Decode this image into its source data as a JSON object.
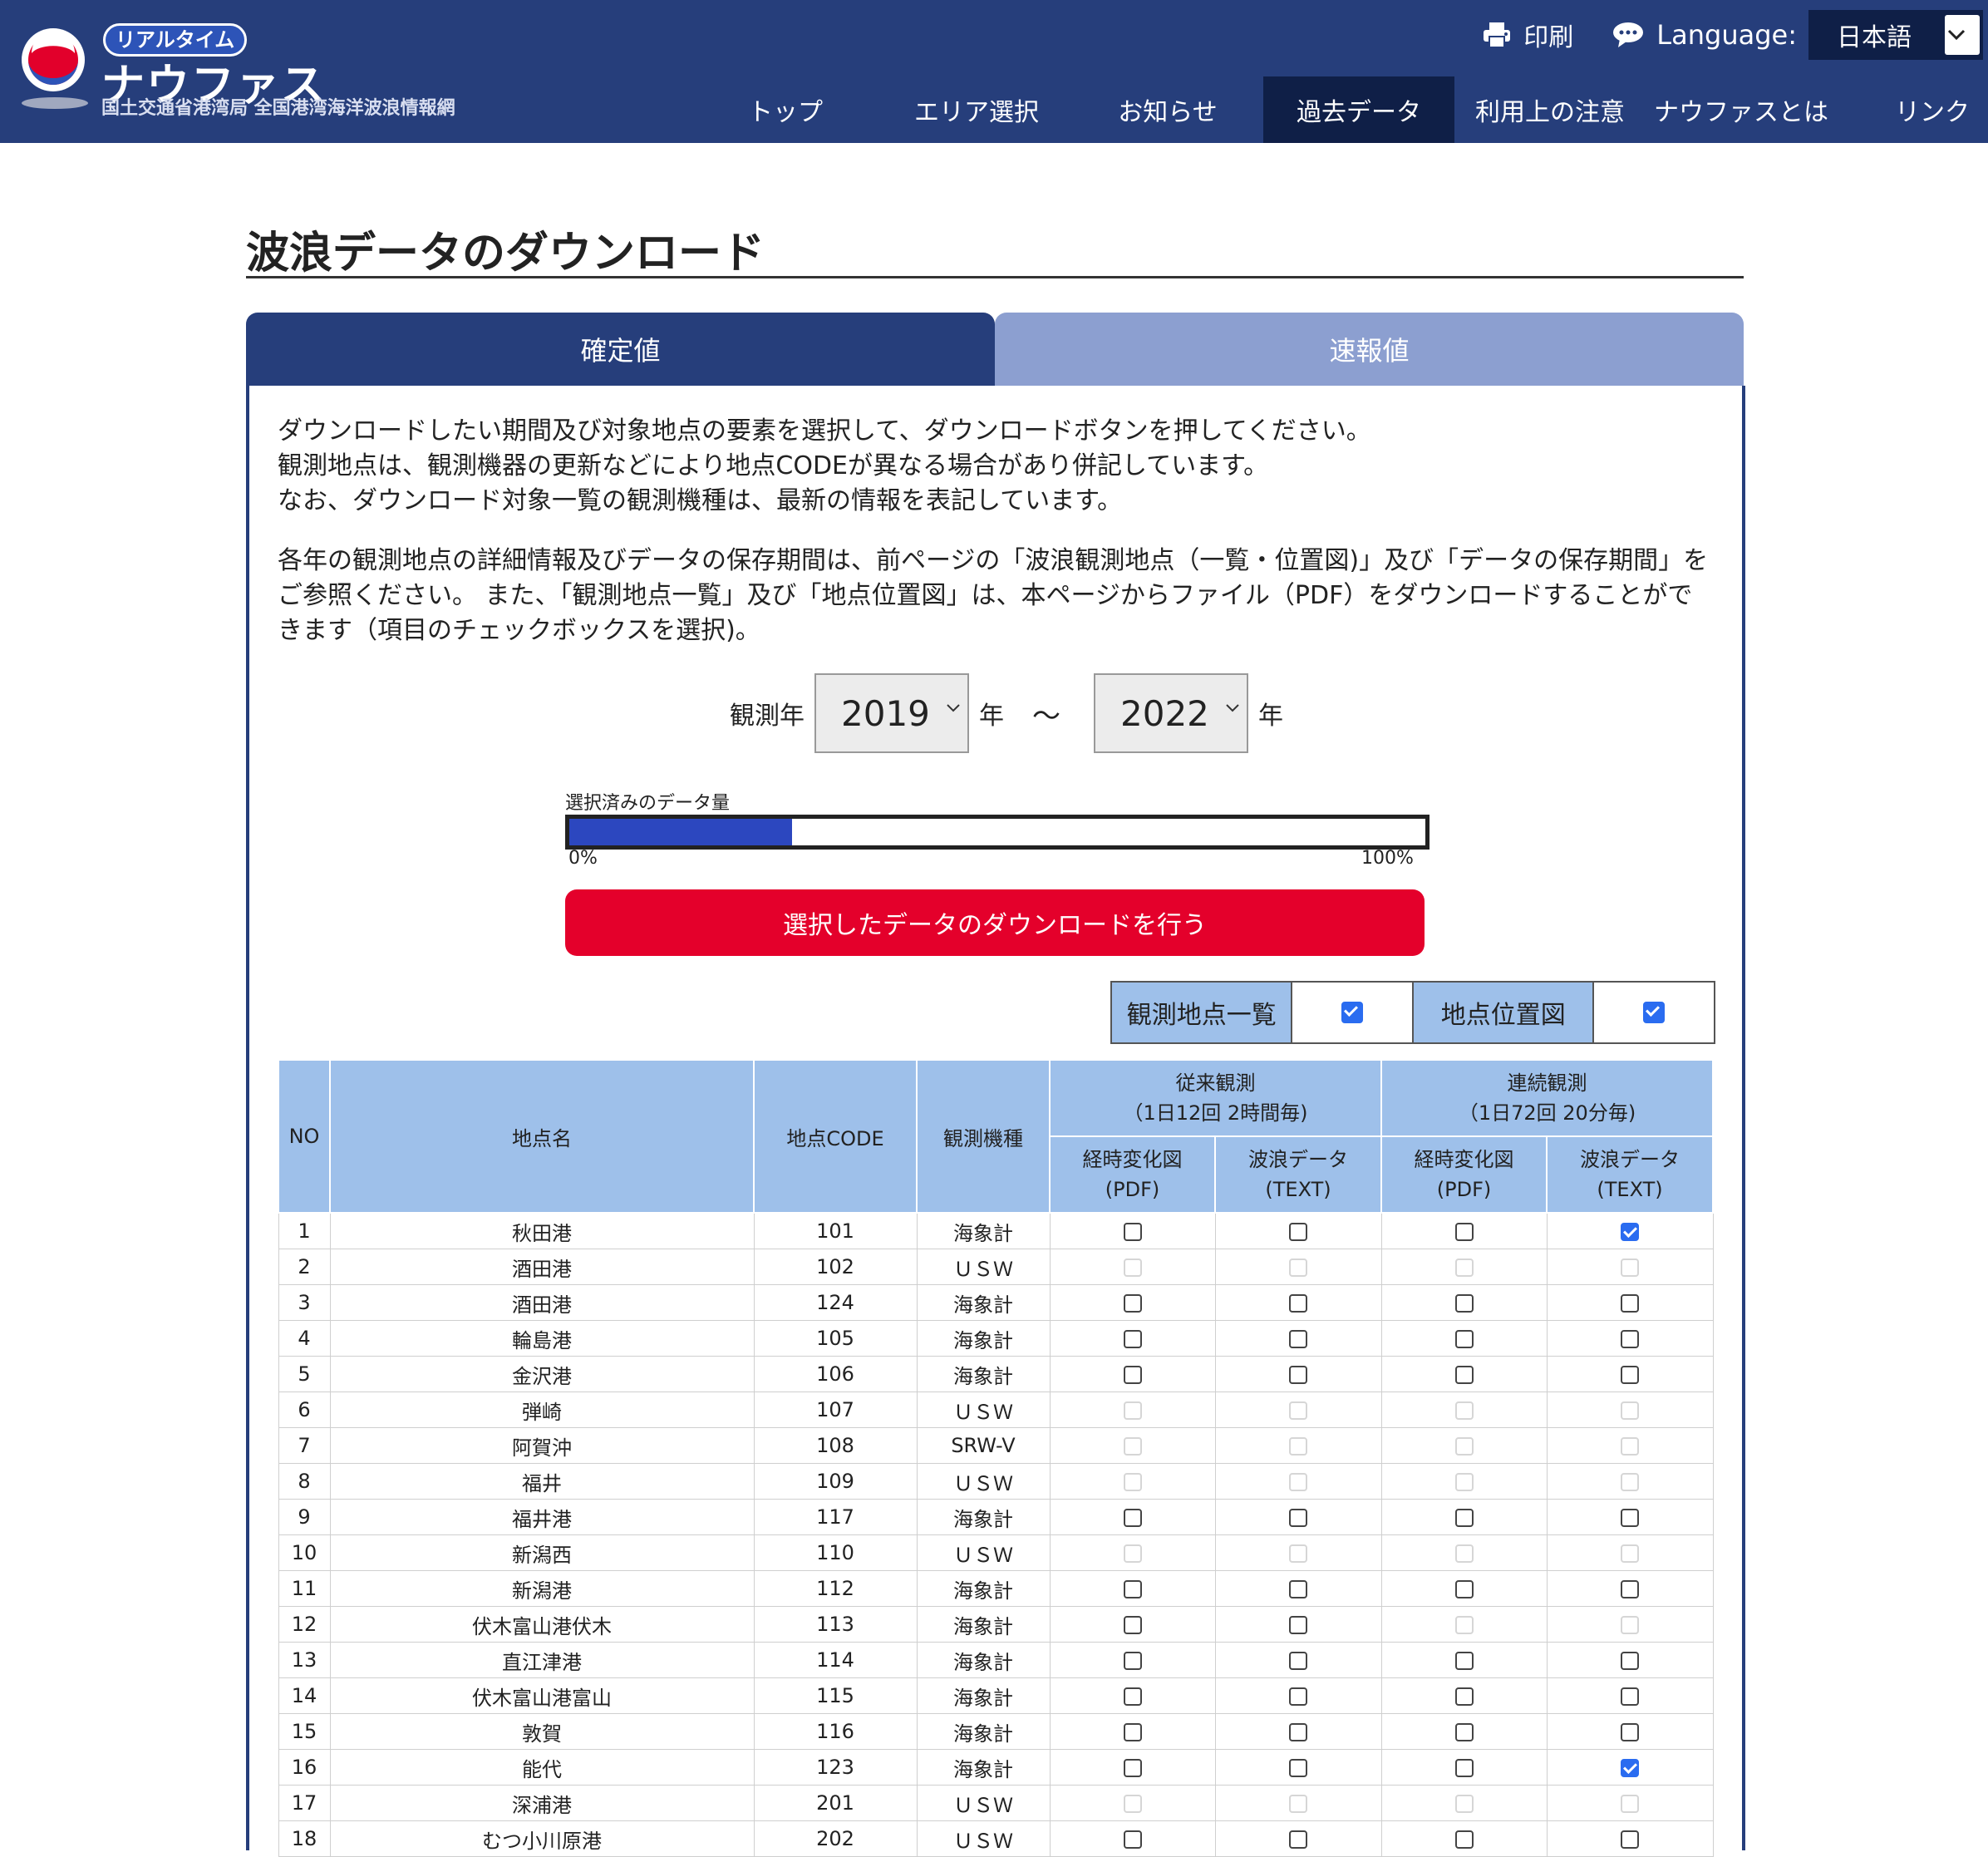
{
  "header": {
    "logo_badge": "リアルタイム",
    "logo_name": "ナウファス",
    "logo_subtitle": "国土交通省港湾局 全国港湾海洋波浪情報網",
    "print_label": "印刷",
    "language_label": "Language:",
    "language_value": "日本語",
    "nav": [
      {
        "label": "トップ"
      },
      {
        "label": "エリア選択"
      },
      {
        "label": "お知らせ"
      },
      {
        "label": "過去データ",
        "active": true
      },
      {
        "label": "利用上の注意"
      },
      {
        "label": "ナウファスとは"
      },
      {
        "label": "リンク"
      }
    ],
    "colors": {
      "header_bg": "#263e7b",
      "active_nav": "#0f1f47"
    }
  },
  "page": {
    "title": "波浪データのダウンロード",
    "tabs": [
      {
        "label": "確定値",
        "active": true
      },
      {
        "label": "速報値",
        "active": false
      }
    ],
    "intro_lines": [
      "ダウンロードしたい期間及び対象地点の要素を選択して、ダウンロードボタンを押してください。",
      "観測地点は、観測機器の更新などにより地点CODEが異なる場合があり併記しています。",
      "なお、ダウンロード対象一覧の観測機種は、最新の情報を表記しています。"
    ],
    "notice_lines": [
      "各年の観測地点の詳細情報及びデータの保存期間は、前ページの「波浪観測地点（一覧・位置図)」及び「データの保存期間」を",
      "ご参照ください。 また、「観測地点一覧」及び「地点位置図」は、本ページからファイル（PDF）をダウンロードすることがで",
      "きます（項目のチェックボックスを選択)。"
    ],
    "year": {
      "label": "観測年",
      "from": "2019",
      "to": "2022",
      "unit": "年",
      "separator": "～"
    },
    "quantity": {
      "label": "選択済みのデータ量",
      "min_label": "0%",
      "max_label": "100%",
      "fill_fraction": 0.26
    },
    "download_button": "選択したデータのダウンロードを行う",
    "options": [
      {
        "label": "観測地点一覧",
        "checked": true
      },
      {
        "label": "地点位置図",
        "checked": true
      }
    ]
  },
  "table": {
    "headers": {
      "no": "NO",
      "name": "地点名",
      "code": "地点CODE",
      "device": "観測機種",
      "group1_line1": "従来観測",
      "group1_line2": "（1日12回 2時間毎)",
      "group2_line1": "連続観測",
      "group2_line2": "（1日72回 20分毎)",
      "sub": [
        {
          "l1": "経時変化図",
          "l2": "(PDF)"
        },
        {
          "l1": "波浪データ",
          "l2": "(TEXT)"
        },
        {
          "l1": "経時変化図",
          "l2": "(PDF)"
        },
        {
          "l1": "波浪データ",
          "l2": "(TEXT)"
        }
      ]
    },
    "rows": [
      {
        "no": "1",
        "name": "秋田港",
        "code": "101",
        "device": "海象計",
        "checks": [
          "off",
          "off",
          "off",
          "on"
        ]
      },
      {
        "no": "2",
        "name": "酒田港",
        "code": "102",
        "device": "ＵＳＷ",
        "checks": [
          "dis",
          "dis",
          "dis",
          "dis"
        ]
      },
      {
        "no": "3",
        "name": "酒田港",
        "code": "124",
        "device": "海象計",
        "checks": [
          "off",
          "off",
          "off",
          "off"
        ]
      },
      {
        "no": "4",
        "name": "輪島港",
        "code": "105",
        "device": "海象計",
        "checks": [
          "off",
          "off",
          "off",
          "off"
        ]
      },
      {
        "no": "5",
        "name": "金沢港",
        "code": "106",
        "device": "海象計",
        "checks": [
          "off",
          "off",
          "off",
          "off"
        ]
      },
      {
        "no": "6",
        "name": "弾崎",
        "code": "107",
        "device": "ＵＳＷ",
        "checks": [
          "dis",
          "dis",
          "dis",
          "dis"
        ]
      },
      {
        "no": "7",
        "name": "阿賀沖",
        "code": "108",
        "device": "SRW-V",
        "checks": [
          "dis",
          "dis",
          "dis",
          "dis"
        ]
      },
      {
        "no": "8",
        "name": "福井",
        "code": "109",
        "device": "ＵＳＷ",
        "checks": [
          "dis",
          "dis",
          "dis",
          "dis"
        ]
      },
      {
        "no": "9",
        "name": "福井港",
        "code": "117",
        "device": "海象計",
        "checks": [
          "off",
          "off",
          "off",
          "off"
        ]
      },
      {
        "no": "10",
        "name": "新潟西",
        "code": "110",
        "device": "ＵＳＷ",
        "checks": [
          "dis",
          "dis",
          "dis",
          "dis"
        ]
      },
      {
        "no": "11",
        "name": "新潟港",
        "code": "112",
        "device": "海象計",
        "checks": [
          "off",
          "off",
          "off",
          "off"
        ]
      },
      {
        "no": "12",
        "name": "伏木富山港伏木",
        "code": "113",
        "device": "海象計",
        "checks": [
          "off",
          "off",
          "dis",
          "dis"
        ]
      },
      {
        "no": "13",
        "name": "直江津港",
        "code": "114",
        "device": "海象計",
        "checks": [
          "off",
          "off",
          "off",
          "off"
        ]
      },
      {
        "no": "14",
        "name": "伏木富山港富山",
        "code": "115",
        "device": "海象計",
        "checks": [
          "off",
          "off",
          "off",
          "off"
        ]
      },
      {
        "no": "15",
        "name": "敦賀",
        "code": "116",
        "device": "海象計",
        "checks": [
          "off",
          "off",
          "off",
          "off"
        ]
      },
      {
        "no": "16",
        "name": "能代",
        "code": "123",
        "device": "海象計",
        "checks": [
          "off",
          "off",
          "off",
          "on"
        ]
      },
      {
        "no": "17",
        "name": "深浦港",
        "code": "201",
        "device": "ＵＳＷ",
        "checks": [
          "dis",
          "dis",
          "dis",
          "dis"
        ]
      },
      {
        "no": "18",
        "name": "むつ小川原港",
        "code": "202",
        "device": "ＵＳＷ",
        "checks": [
          "off",
          "off",
          "off",
          "off"
        ]
      }
    ]
  }
}
